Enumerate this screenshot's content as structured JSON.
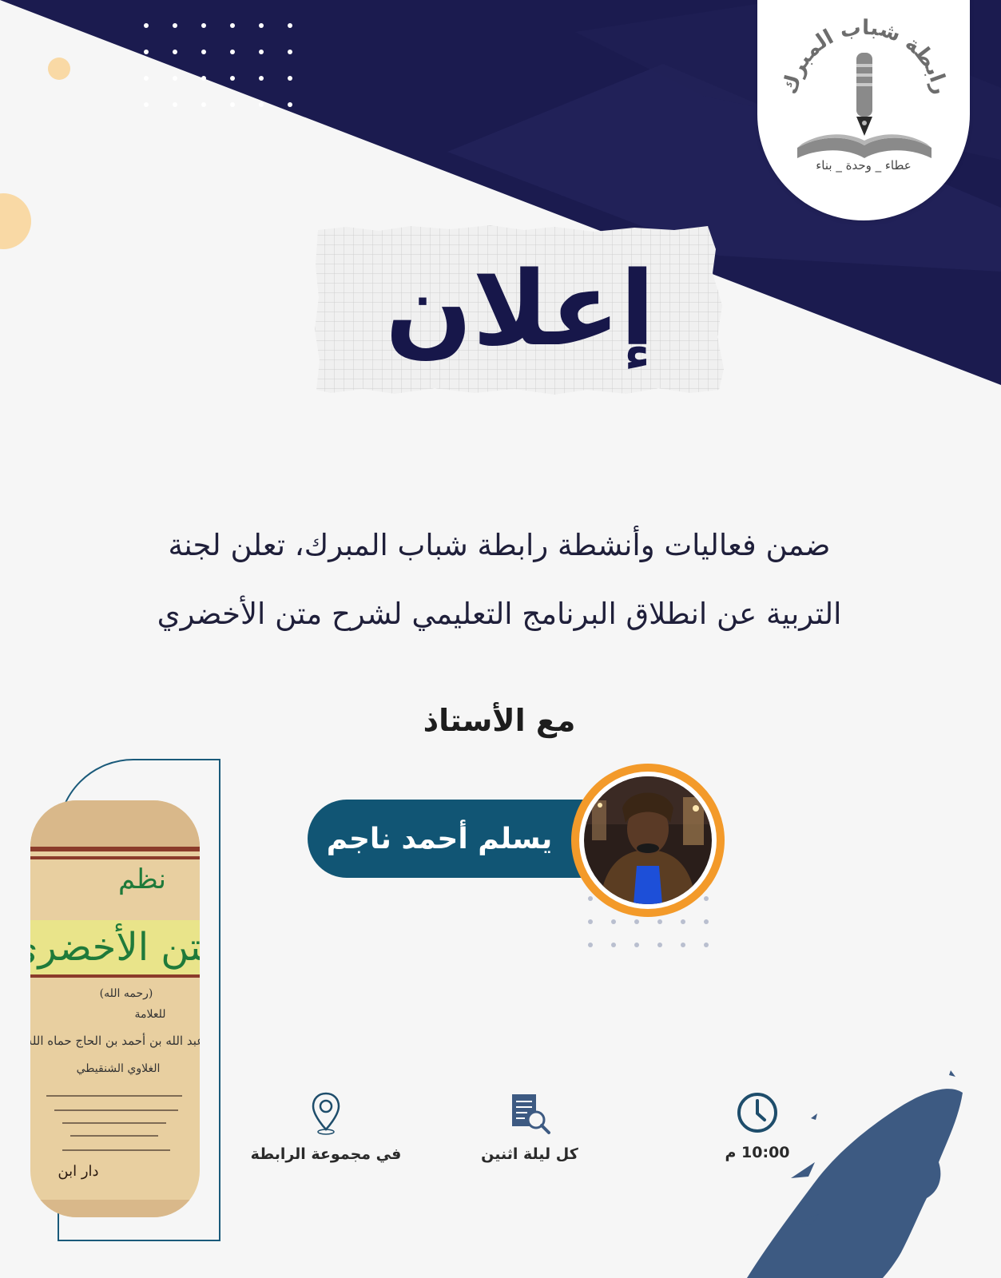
{
  "colors": {
    "navy": "#17174a",
    "dark_band": "#1b1b4f",
    "teal_pill": "#115574",
    "orange_ring": "#f39a2a",
    "peach_circle": "#f9d9a5",
    "brush_blue": "#3d5a82",
    "background": "#f6f6f6"
  },
  "logo": {
    "name": "رابطة شباب المبرك",
    "motto": "عطاء _ وحدة _ بناء",
    "icon": "pen-and-book-logo"
  },
  "title": "إعلان",
  "announcement": {
    "line1": "ضمن فعاليات وأنشطة رابطة شباب المبرك، تعلن لجنة",
    "line2": "التربية عن انطلاق البرنامج التعليمي لشرح  متن الأخضري"
  },
  "with_teacher": "مع الأستاذ",
  "teacher": {
    "name": "يسلم أحمد ناجم",
    "photo_icon": "teacher-photo"
  },
  "book": {
    "title_small": "نظم",
    "title_big": "متن الأخضري",
    "line_1": "(رحمه الله)",
    "line_2": "للعلامة",
    "line_3": "عبد الله بن أحمد بن الحاج حماه الله",
    "line_4": "الغلاوي الشنقيطي",
    "publisher": "دار ابن"
  },
  "info": {
    "time": {
      "icon": "clock-icon",
      "label": "10:00 م"
    },
    "day": {
      "icon": "document-search-icon",
      "label": "كل ليلة اثنين"
    },
    "place": {
      "icon": "location-pin-icon",
      "label": "في مجموعة الرابطة"
    }
  }
}
